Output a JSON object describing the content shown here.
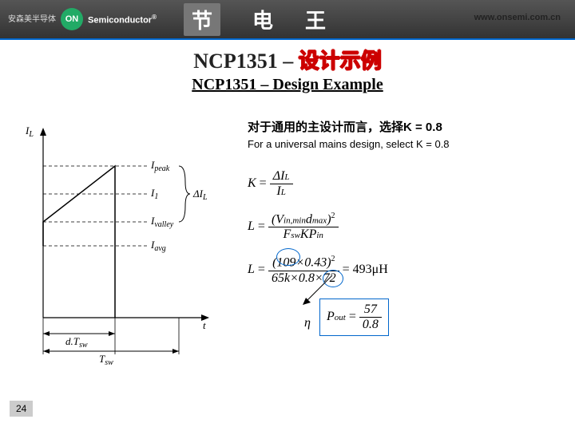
{
  "header": {
    "logo_cn_line1": "安森美半导体",
    "logo_icon": "ON",
    "logo_text": "Semiconductor",
    "banner_box": "节",
    "banner_char1": "电",
    "banner_char2": "王",
    "url": "www.onsemi.com.cn"
  },
  "title": {
    "prefix": "NCP1351 – ",
    "cn_suffix": "设计示例",
    "en": "NCP1351 – Design Example"
  },
  "notes": {
    "cn": "对于通用的主设计而言，选择K = 0.8",
    "en": "For a universal mains design, select K = 0.8"
  },
  "equations": {
    "k_lhs": "K",
    "k_num": "ΔI",
    "k_num_sub": "L",
    "k_den": "I",
    "k_den_sub": "L",
    "l_lhs": "L",
    "l_num_base": "V",
    "l_num_sub1": "in,min",
    "l_num_d": "d",
    "l_num_sub2": "max",
    "l_num_exp": "2",
    "l_den_f": "F",
    "l_den_fsub": "sw",
    "l_den_k": "K",
    "l_den_p": "P",
    "l_den_psub": "in",
    "calc_num": "(109×0.43)",
    "calc_num_exp": "2",
    "calc_den": "65k×0.8×72",
    "calc_result": "= 493μH",
    "boxed_lhs": "P",
    "boxed_lhs_sub": "out",
    "boxed_num": "57",
    "boxed_den": "0.8",
    "boxed_rhs_sym": "η"
  },
  "diagram": {
    "y_axis": "I",
    "y_axis_sub": "L",
    "x_axis": "t",
    "l_peak": "I",
    "l_peak_sub": "peak",
    "l_I1": "I",
    "l_I1_sub": "1",
    "l_valley": "I",
    "l_valley_sub": "valley",
    "l_avg": "I",
    "l_avg_sub": "avg",
    "delta": "ΔI",
    "delta_sub": "L",
    "dTsw": "d.T",
    "dTsw_sub": "sw",
    "Tsw": "T",
    "Tsw_sub": "sw"
  },
  "page_number": "24"
}
